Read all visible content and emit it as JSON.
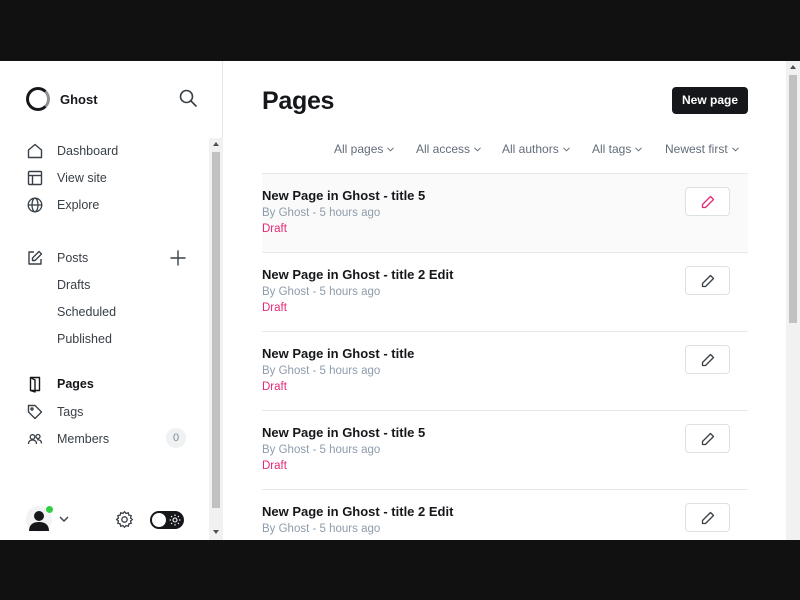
{
  "brand": {
    "name": "Ghost",
    "icon": "ghost-logo"
  },
  "sidebar": {
    "search_icon": "search-icon",
    "nav_top": [
      {
        "label": "Dashboard",
        "icon": "home-icon"
      },
      {
        "label": "View site",
        "icon": "layout-icon"
      },
      {
        "label": "Explore",
        "icon": "globe-icon"
      }
    ],
    "posts": {
      "label": "Posts",
      "icon": "edit-icon",
      "add_icon": "plus-icon"
    },
    "post_subitems": [
      "Drafts",
      "Scheduled",
      "Published"
    ],
    "nav_bottom": [
      {
        "label": "Pages",
        "icon": "page-icon",
        "active": true
      },
      {
        "label": "Tags",
        "icon": "tag-icon"
      },
      {
        "label": "Members",
        "icon": "members-icon"
      }
    ],
    "members_count": "0",
    "footer": {
      "avatar_icon": "user-avatar-icon",
      "status_color": "#30cf43",
      "settings_icon": "gear-icon",
      "theme_icon": "sun-icon"
    }
  },
  "main": {
    "title": "Pages",
    "new_button": "New page",
    "filters": [
      "All pages",
      "All access",
      "All authors",
      "All tags",
      "Newest first"
    ],
    "rows": [
      {
        "title": "New Page in Ghost - title 5",
        "meta": "By Ghost - 5 hours ago",
        "status": "Draft"
      },
      {
        "title": "New Page in Ghost - title 2 Edit",
        "meta": "By Ghost - 5 hours ago",
        "status": "Draft"
      },
      {
        "title": "New Page in Ghost - title",
        "meta": "By Ghost - 5 hours ago",
        "status": "Draft"
      },
      {
        "title": "New Page in Ghost - title 5",
        "meta": "By Ghost - 5 hours ago",
        "status": "Draft"
      },
      {
        "title": "New Page in Ghost - title 2 Edit",
        "meta": "By Ghost - 5 hours ago",
        "status": ""
      }
    ],
    "edit_icon": "pencil-icon"
  },
  "colors": {
    "accent": "#15171a",
    "draft": "#e32a77",
    "online": "#30cf43"
  }
}
